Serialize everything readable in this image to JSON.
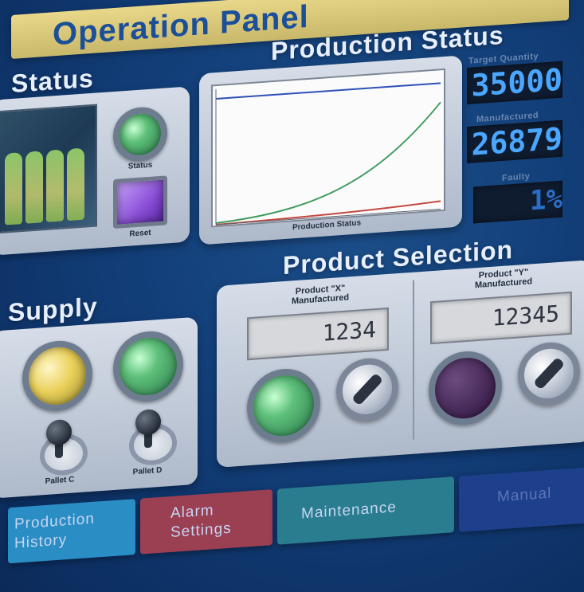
{
  "header": {
    "title": "Operation Panel"
  },
  "sections": {
    "status": "Status",
    "production_status": "Production Status",
    "supply": "Supply",
    "product_selection": "Product Selection"
  },
  "status_panel": {
    "status_label": "Status",
    "reset_label": "Reset"
  },
  "production_status": {
    "chart_caption": "Production Status",
    "target_quantity_label": "Target Quantity",
    "target_quantity_value": "35000",
    "manufactured_label": "Manufactured",
    "manufactured_value": "26879",
    "faulty_label": "Faulty",
    "faulty_value": "1%"
  },
  "supply_panel": {
    "pallet_c": "Pallet C",
    "pallet_d": "Pallet D"
  },
  "product_selection": {
    "product_x_line1": "Product \"X\"",
    "product_x_line2": "Manufactured",
    "product_x_value": "1234",
    "product_y_line1": "Product \"Y\"",
    "product_y_line2": "Manufactured",
    "product_y_value": "12345"
  },
  "nav": {
    "production_history_line1": "Production",
    "production_history_line2": "History",
    "alarm_settings_line1": "Alarm",
    "alarm_settings_line2": "Settings",
    "maintenance": "Maintenance",
    "manual": "Manual"
  },
  "colors": {
    "accent_blue": "#1b4f98",
    "lamp_green": "#5ec07a",
    "lamp_yellow": "#ead05a",
    "alarm_red": "#b8464a",
    "maintenance_teal": "#2a7c8f",
    "history_cyan": "#2a8dc4"
  }
}
